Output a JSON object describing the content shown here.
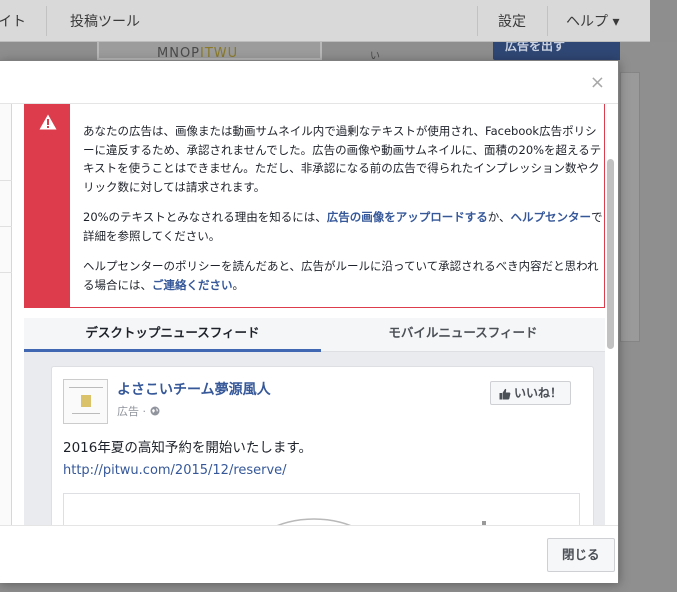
{
  "background": {
    "topbar": {
      "left_fragment": "イト",
      "tool_link": "投稿ツール",
      "settings": "設定",
      "help": "ヘルプ ▾"
    },
    "ad_button": "広告を出す",
    "card_text_a": "MNOP",
    "card_text_b": "ITWU",
    "card_side": "い"
  },
  "modal": {
    "close_symbol": "×",
    "alert": {
      "icon": "warning-triangle-icon",
      "para1": "あなたの広告は、画像または動画サムネイル内で過剰なテキストが使用され、Facebook広告ポリシーに違反するため、承認されませんでした。広告の画像や動画サムネイルに、面積の20%を超えるテキストを使うことはできません。ただし、非承認になる前の広告で得られたインプレッション数やクリック数に対しては請求されます。",
      "para2_prefix": "20%のテキストとみなされる理由を知るには、",
      "para2_link1": "広告の画像をアップロードする",
      "para2_mid": "か、",
      "para2_link2": "ヘルプセンター",
      "para2_suffix": "で詳細を参照してください。",
      "para3_prefix": "ヘルプセンターのポリシーを読んだあと、広告がルールに沿っていて承認されるべき内容だと思われる場合には、",
      "para3_link": "ご連絡ください",
      "para3_suffix": "。"
    },
    "tabs": [
      {
        "label": "デスクトップニュースフィード",
        "active": true
      },
      {
        "label": "モバイルニュースフィード",
        "active": false
      }
    ],
    "post": {
      "page_name": "よさこいチーム夢源風人",
      "sponsored": "広告 · ",
      "like_label": "いいね！",
      "text": "2016年夏の高知予約を開始いたします。",
      "link": "http://pitwu.com/2015/12/reserve/"
    },
    "footer": {
      "close_label": "閉じる"
    }
  },
  "colors": {
    "alert_red": "#dd3c4c",
    "link_blue": "#365899",
    "tab_active": "#4267b2"
  }
}
